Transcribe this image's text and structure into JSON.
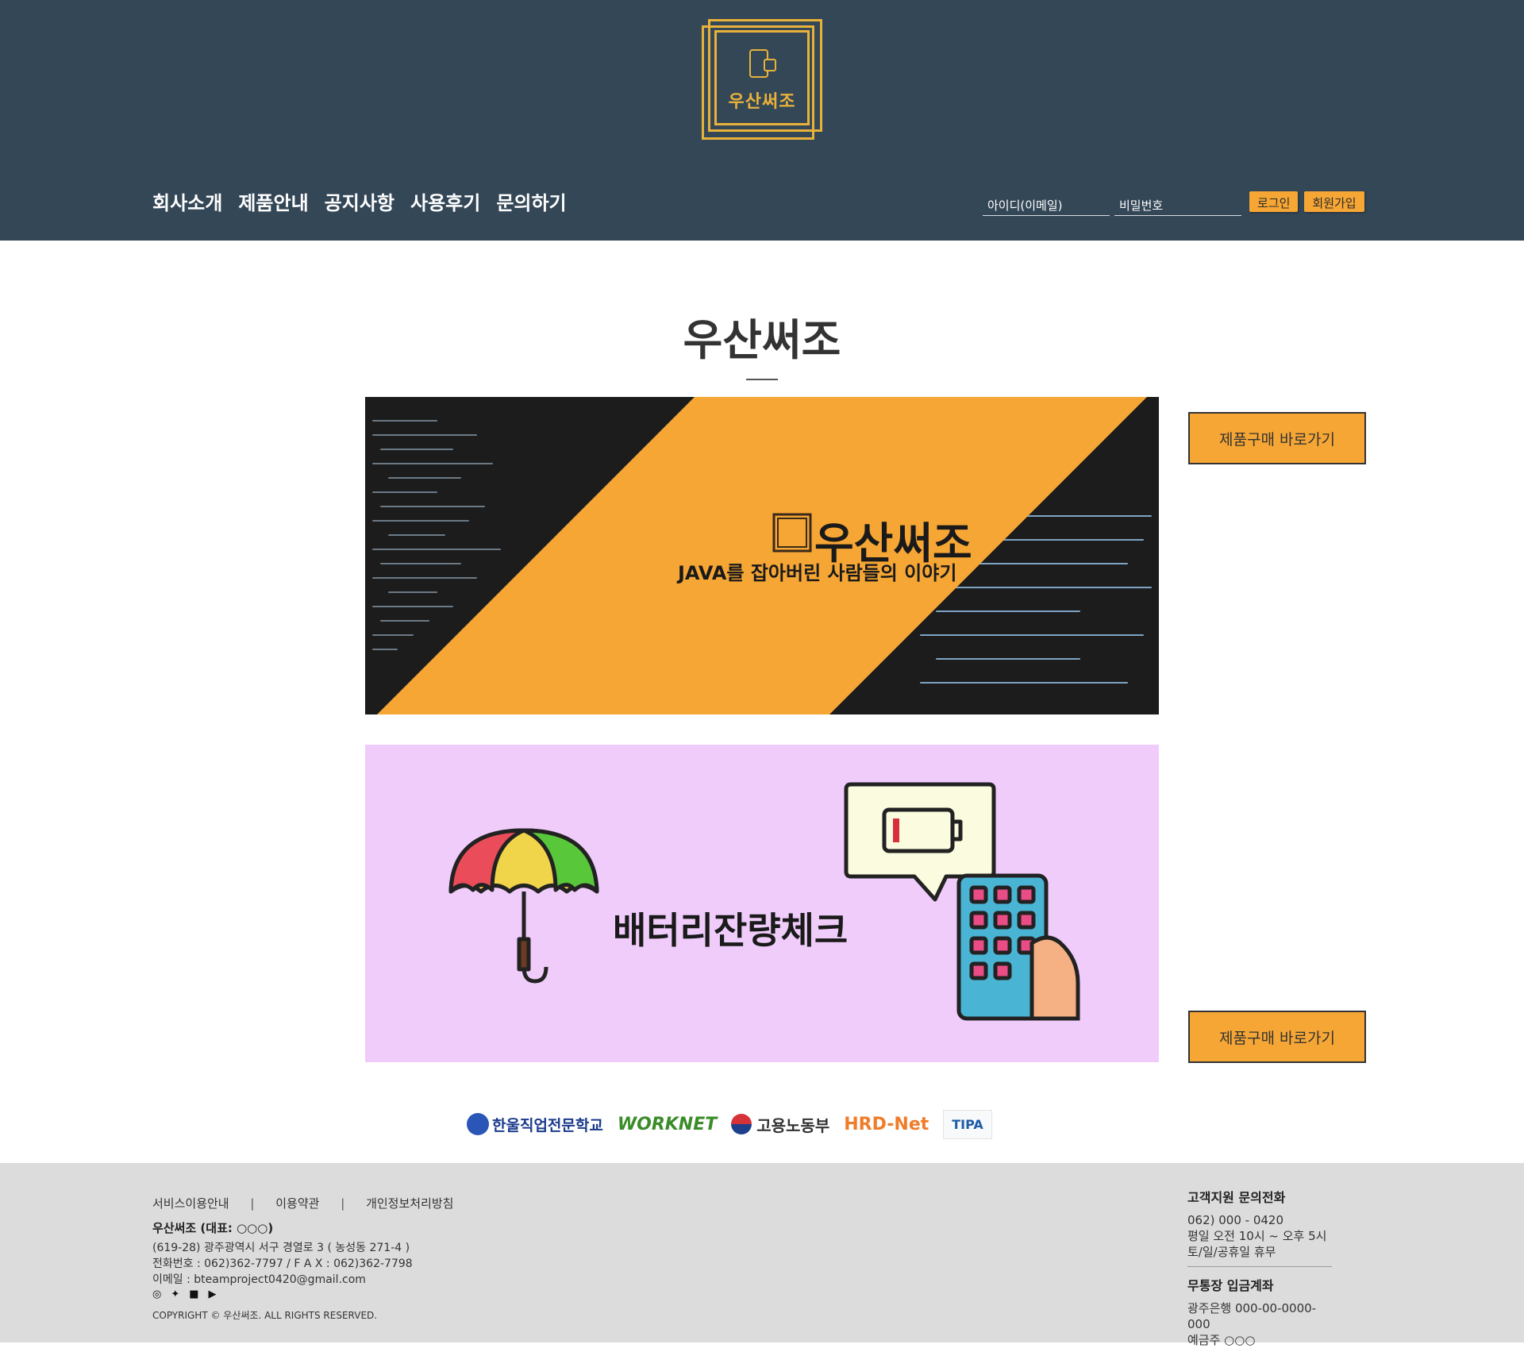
{
  "header": {
    "logo_text": "우산써조",
    "nav": [
      "회사소개",
      "제품안내",
      "공지사항",
      "사용후기",
      "문의하기"
    ],
    "login": {
      "id_placeholder": "아이디(이메일)",
      "pw_placeholder": "비밀번호",
      "login_label": "로그인",
      "join_label": "회원가입"
    }
  },
  "main": {
    "title": "우산써조",
    "banner1": {
      "brand": "우산써조",
      "subtitle": "JAVA를 잡아버린 사람들의 이야기"
    },
    "banner2": {
      "title": "배터리잔량체크"
    },
    "buy_label": "제품구매 바로가기"
  },
  "partners": [
    "한울직업전문학교",
    "WORKNET",
    "고용노동부",
    "HRD-Net",
    "TIPA"
  ],
  "footer": {
    "links": [
      "서비스이용안내",
      "이용약관",
      "개인정보처리방침"
    ],
    "separator": "|",
    "company": "우산써조 (대표: ○○○)",
    "address": "(619-28) 광주광역시 서구 경열로 3 ( 농성동 271-4 )",
    "phone_fax": "전화번호 : 062)362-7797 / F A X : 062)362-7798",
    "email": "이메일 : bteamproject0420@gmail.com",
    "copyright": "COPYRIGHT © 우산써조. ALL RIGHTS RESERVED.",
    "support": {
      "title": "고객지원 문의전화",
      "phone": "062) 000 - 0420",
      "hours": "평일 오전 10시 ~ 오후 5시",
      "holiday": "토/일/공휴일 휴무"
    },
    "bank": {
      "title": "무통장 입금계좌",
      "account": "광주은행 000-00-0000-000",
      "holder": "예금주 ○○○"
    }
  },
  "colors": {
    "header_bg": "#344757",
    "accent": "#f6a634",
    "banner2_bg": "#f0ccfb",
    "footer_bg": "#dcdcdd"
  }
}
